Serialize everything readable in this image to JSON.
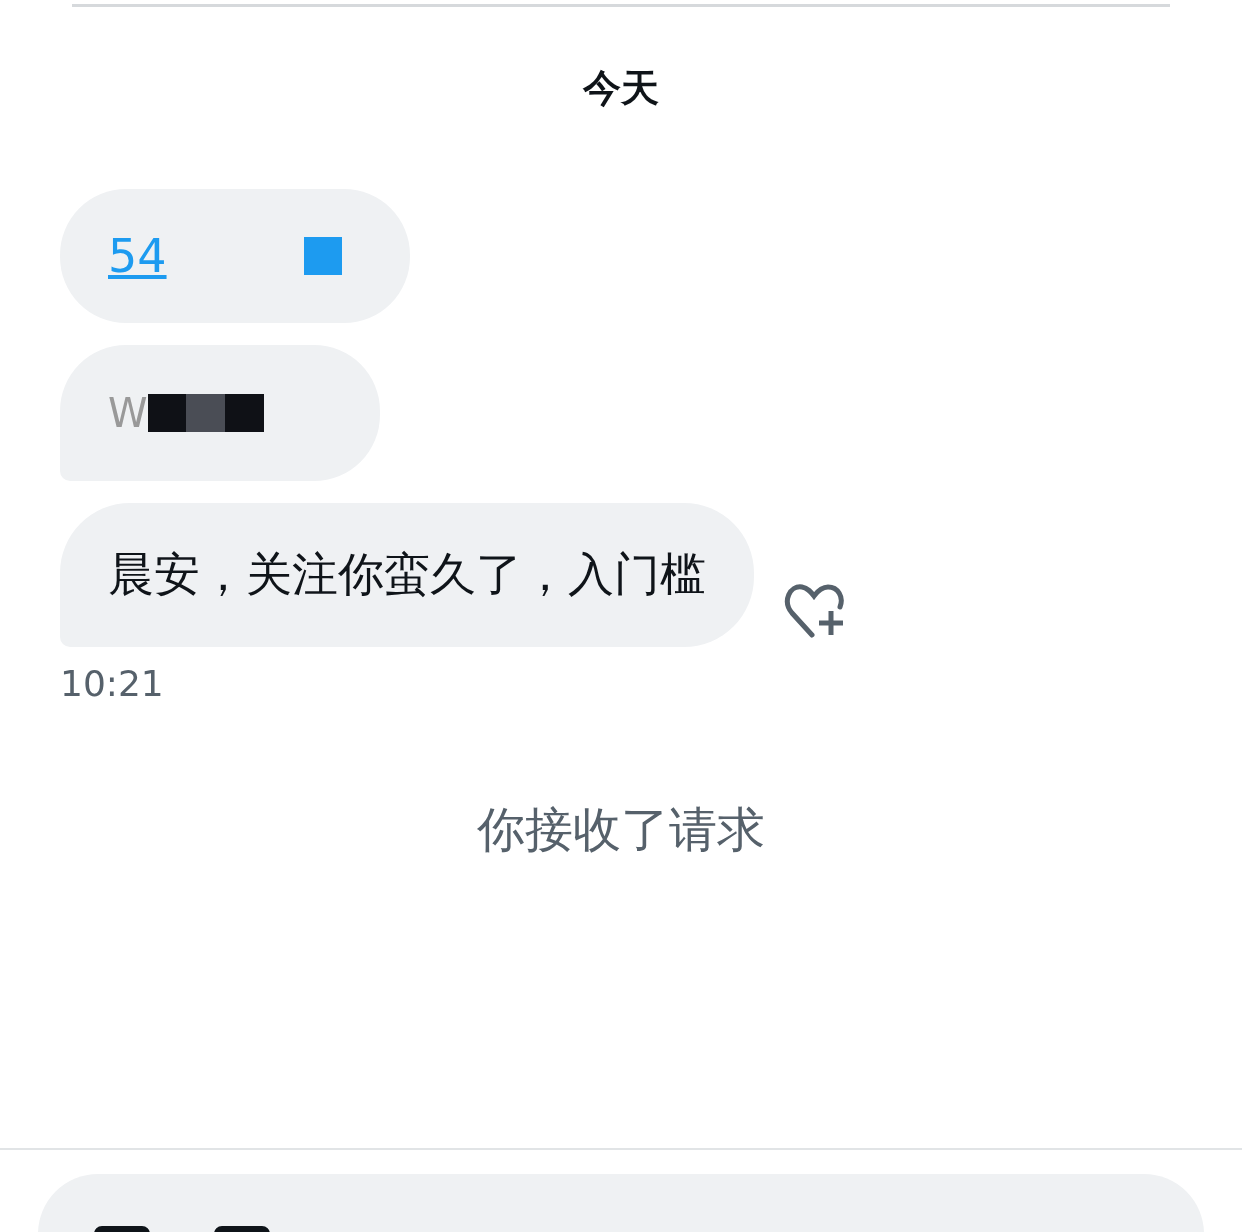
{
  "date_divider": "今天",
  "messages": [
    {
      "kind": "link",
      "text": "54"
    },
    {
      "kind": "redacted",
      "text": "W"
    },
    {
      "kind": "text",
      "text": "晨安，关注你蛮久了，入门槛"
    }
  ],
  "time": "10:21",
  "system_notice": "你接收了请求"
}
